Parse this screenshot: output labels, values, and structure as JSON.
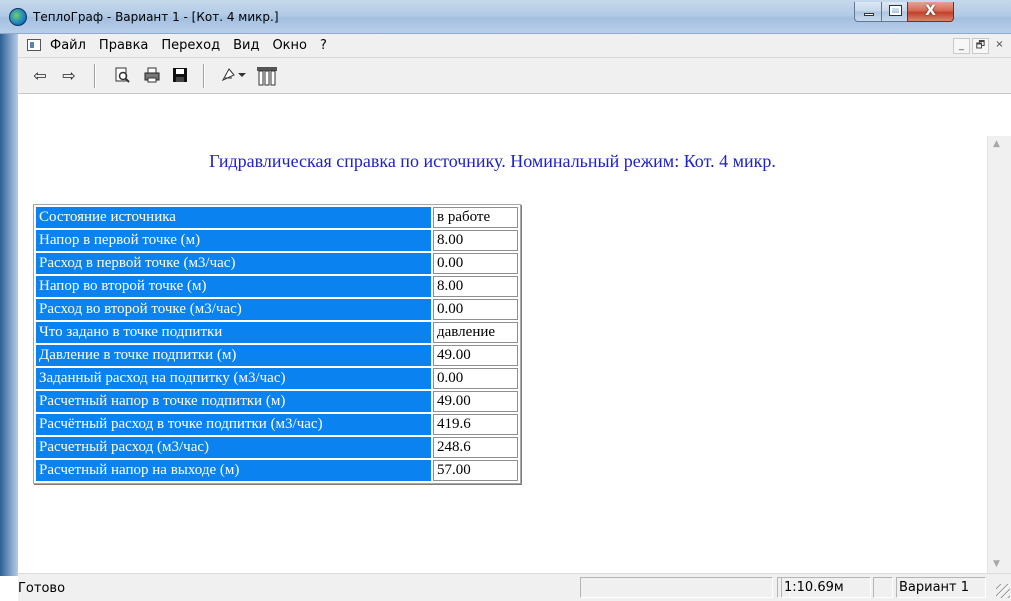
{
  "window": {
    "title": "ТеплоГраф - Вариант 1 - [Кот. 4 микр.]",
    "close_glyph": "X"
  },
  "menu": {
    "items": [
      "Файл",
      "Правка",
      "Переход",
      "Вид",
      "Окно",
      "?"
    ],
    "mdi_min": "_",
    "mdi_restore": "🗗",
    "mdi_close": "×"
  },
  "toolbar": {
    "icons": [
      "back-arrow-icon",
      "forward-arrow-icon",
      "print-preview-icon",
      "print-icon",
      "save-icon",
      "paint-tools-icon",
      "tools-icon"
    ]
  },
  "report": {
    "heading": "Гидравлическая справка по источнику. Номинальный режим: Кот. 4 микр.",
    "rows": [
      {
        "label": "Состояние источника",
        "value": "в работе"
      },
      {
        "label": "Напор в первой точке (м)",
        "value": "8.00"
      },
      {
        "label": "Расход в первой точке (м3/час)",
        "value": "0.00"
      },
      {
        "label": "Напор во второй точке (м)",
        "value": "8.00"
      },
      {
        "label": "Расход во второй точке (м3/час)",
        "value": "0.00"
      },
      {
        "label": "Что задано в точке подпитки",
        "value": "давление"
      },
      {
        "label": "Давление в точке подпитки (м)",
        "value": "49.00"
      },
      {
        "label": "Заданный расход на подпитку (м3/час)",
        "value": "0.00"
      },
      {
        "label": "Расчетный напор в точке подпитки (м)",
        "value": "49.00"
      },
      {
        "label": "Расчётный расход в точке подпитки (м3/час)",
        "value": "419.6"
      },
      {
        "label": "Расчетный расход (м3/час)",
        "value": "248.6"
      },
      {
        "label": "Расчетный напор на выходе (м)",
        "value": "57.00"
      }
    ]
  },
  "statusbar": {
    "ready": "Готово",
    "scale": "1:10.69м",
    "variant": "Вариант 1"
  },
  "colors": {
    "heading": "#1d22c9",
    "label_bg": "#0a82f0"
  }
}
